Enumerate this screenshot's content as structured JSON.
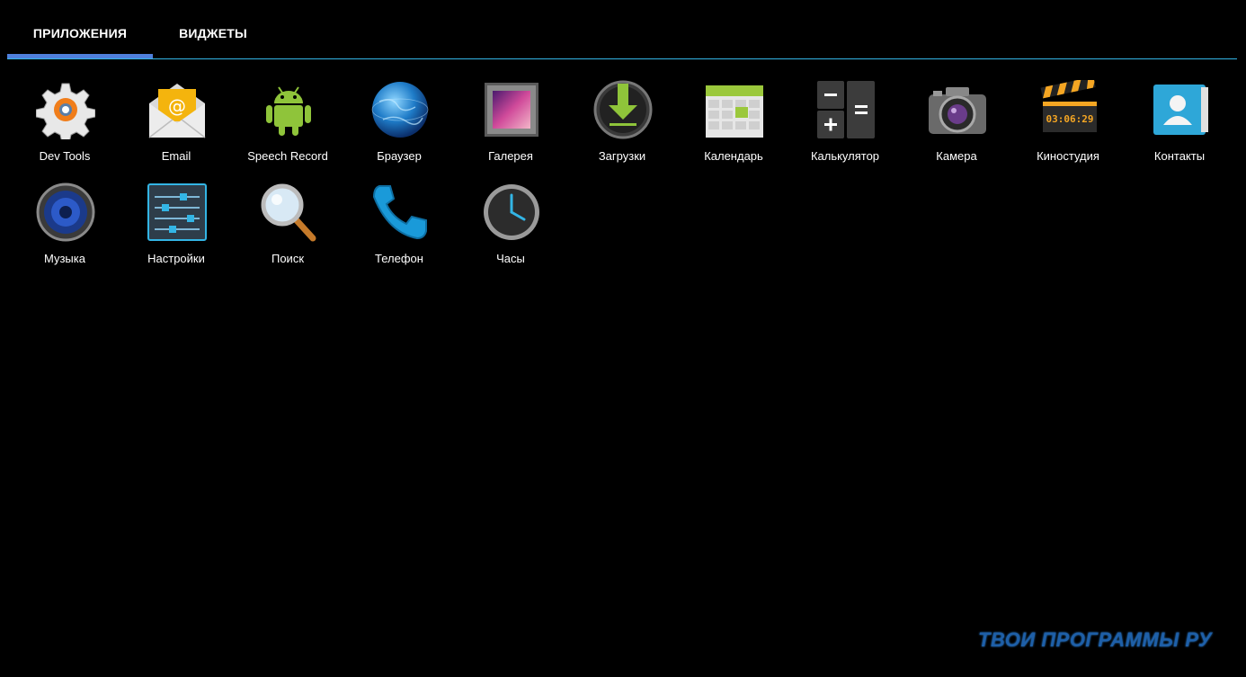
{
  "tabs": {
    "apps": "ПРИЛОЖЕНИЯ",
    "widgets": "ВИДЖЕТЫ"
  },
  "apps": [
    {
      "label": "Dev Tools",
      "icon": "gear-icon"
    },
    {
      "label": "Email",
      "icon": "envelope-icon"
    },
    {
      "label": "Speech Record",
      "icon": "android-robot-icon"
    },
    {
      "label": "Браузер",
      "icon": "globe-icon"
    },
    {
      "label": "Галерея",
      "icon": "gallery-icon"
    },
    {
      "label": "Загрузки",
      "icon": "download-icon"
    },
    {
      "label": "Календарь",
      "icon": "calendar-icon"
    },
    {
      "label": "Калькулятор",
      "icon": "calculator-icon"
    },
    {
      "label": "Камера",
      "icon": "camera-icon"
    },
    {
      "label": "Киностудия",
      "icon": "clapperboard-icon"
    },
    {
      "label": "Контакты",
      "icon": "contacts-icon"
    },
    {
      "label": "Музыка",
      "icon": "speaker-icon"
    },
    {
      "label": "Настройки",
      "icon": "sliders-icon"
    },
    {
      "label": "Поиск",
      "icon": "magnifier-icon"
    },
    {
      "label": "Телефон",
      "icon": "phone-icon"
    },
    {
      "label": "Часы",
      "icon": "clock-icon"
    }
  ],
  "movie_time": "03:06:29",
  "watermark": "ТВОИ ПРОГРАММЫ РУ",
  "colors": {
    "accent": "#33b5e5",
    "tab_indicator": "#4f7fdc",
    "background": "#000000"
  }
}
